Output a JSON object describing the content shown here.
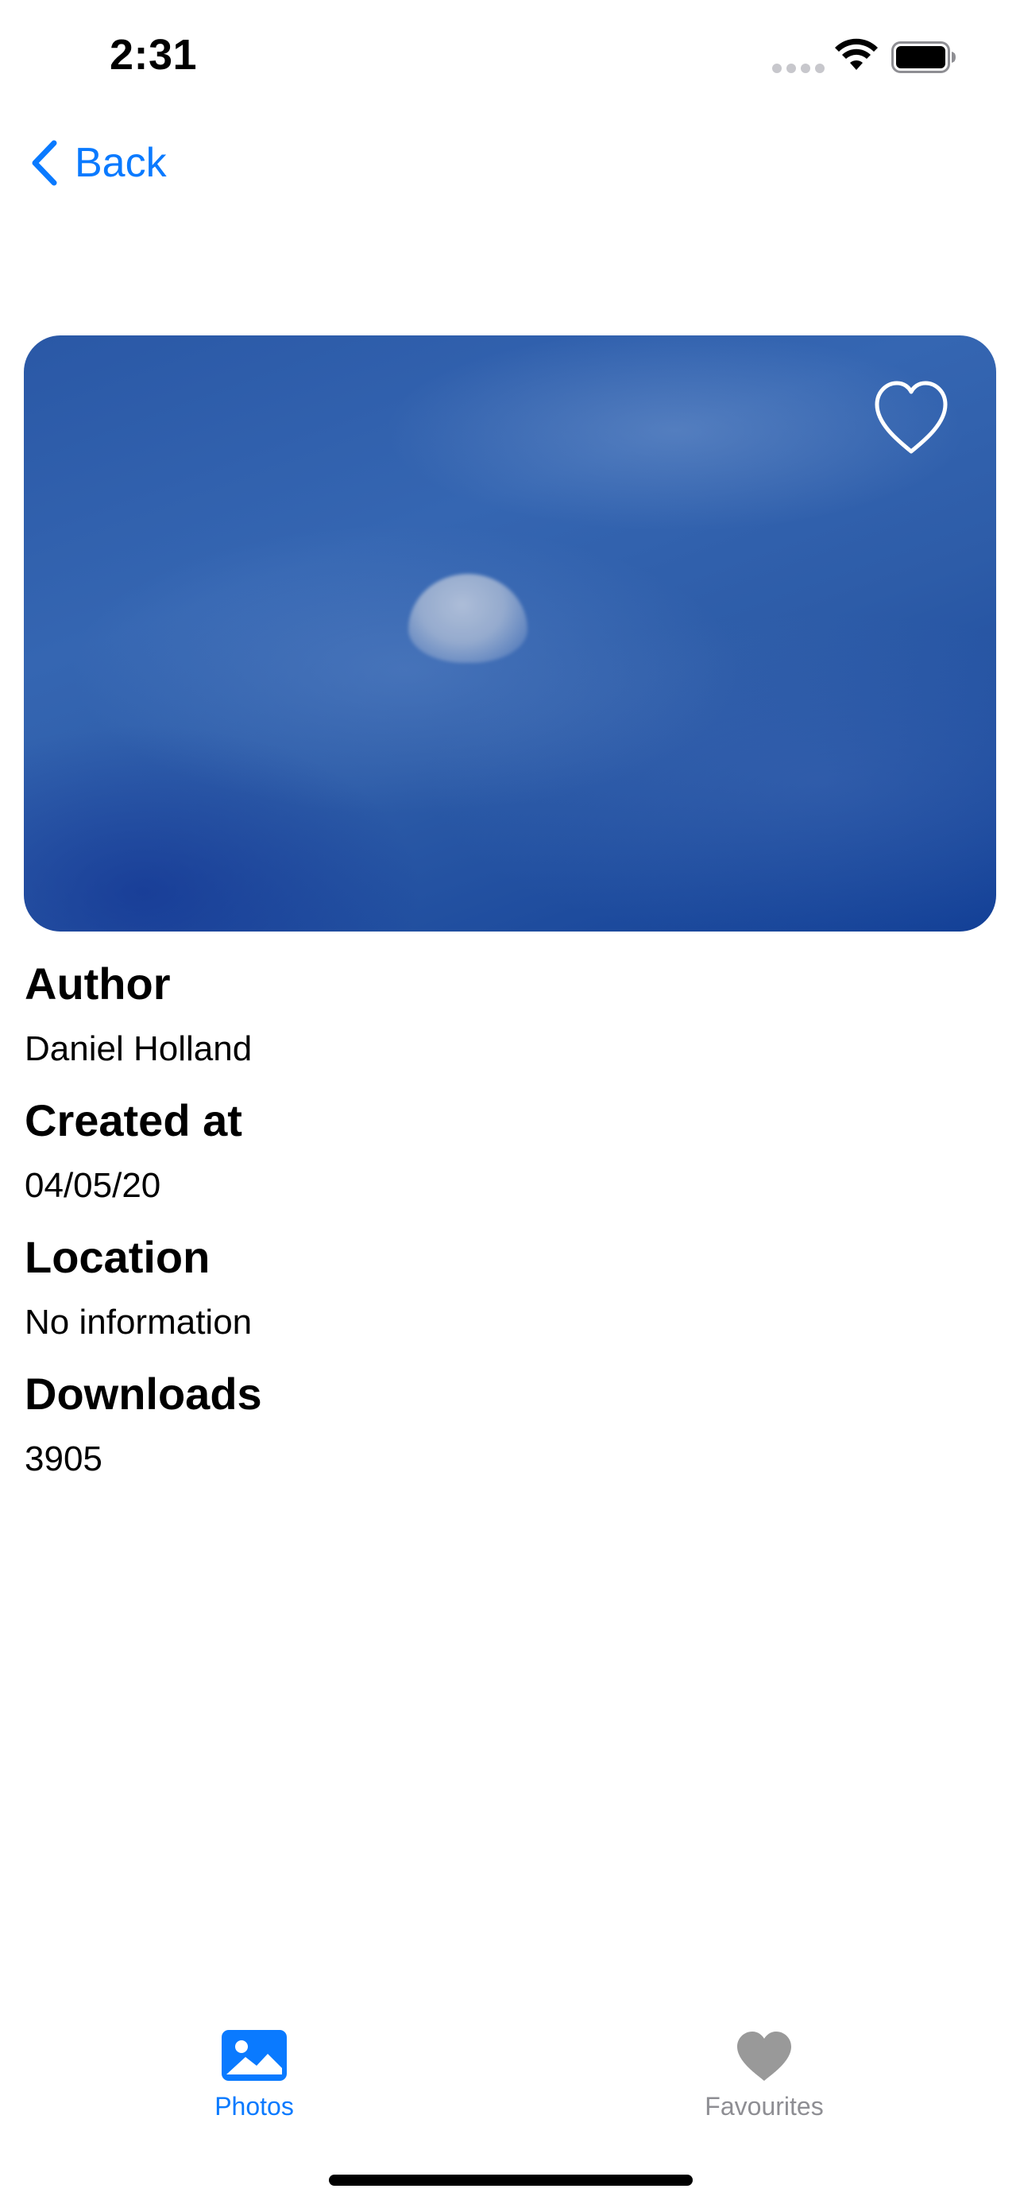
{
  "status_bar": {
    "time": "2:31"
  },
  "nav": {
    "back_label": "Back"
  },
  "photo": {
    "favourite_icon": "heart-outline-icon"
  },
  "details": {
    "author_heading": "Author",
    "author_value": "Daniel Holland",
    "created_heading": "Created at",
    "created_value": "04/05/20",
    "location_heading": "Location",
    "location_value": "No information",
    "downloads_heading": "Downloads",
    "downloads_value": "3905"
  },
  "tab_bar": {
    "tabs": [
      {
        "label": "Photos",
        "icon": "photo-icon",
        "selected": true
      },
      {
        "label": "Favourites",
        "icon": "heart-icon",
        "selected": false
      }
    ]
  },
  "colors": {
    "accent": "#0a7aff",
    "inactive": "#8e8e93"
  }
}
